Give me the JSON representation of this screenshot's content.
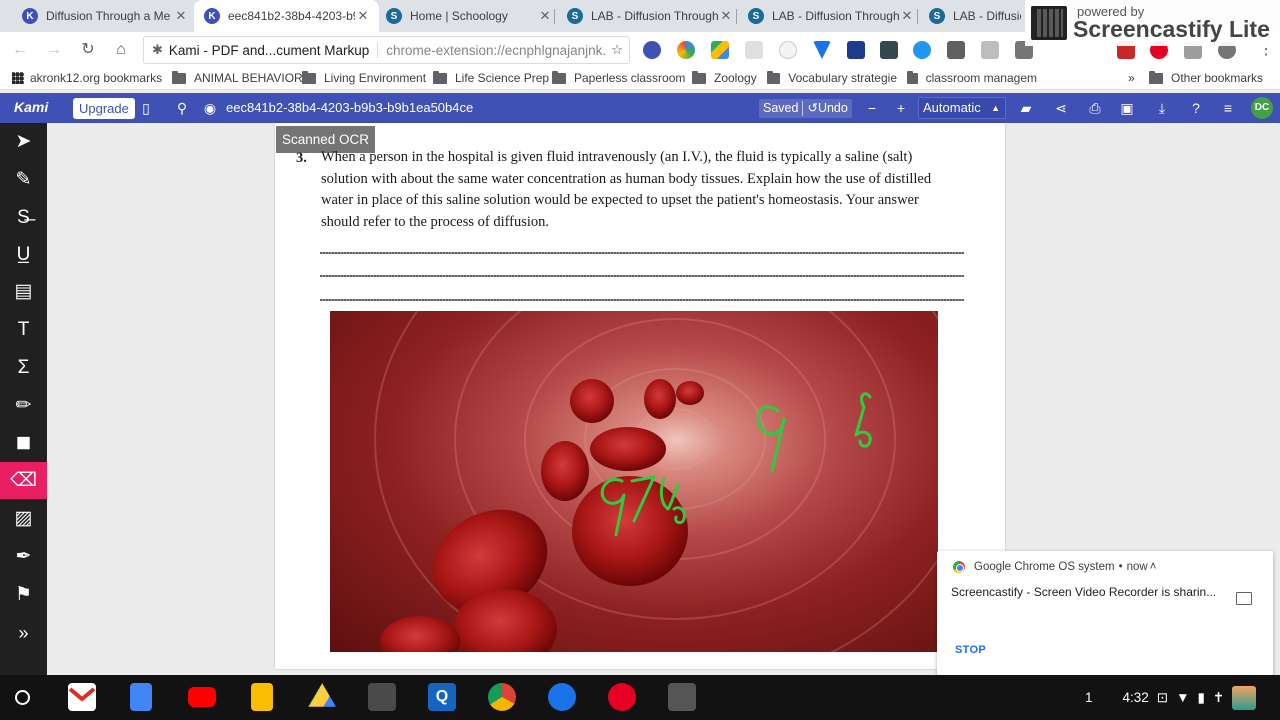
{
  "tabs": [
    {
      "title": "Diffusion Through a Me",
      "favicon": "K",
      "favicon_color": "#3f51b5",
      "active": false
    },
    {
      "title": "eec841b2-38b4-4203-b9",
      "favicon": "K",
      "favicon_color": "#3f51b5",
      "active": true
    },
    {
      "title": "Home | Schoology",
      "favicon": "S",
      "favicon_color": "#1a6a9a",
      "active": false
    },
    {
      "title": "LAB - Diffusion Through",
      "favicon": "S",
      "favicon_color": "#1a6a9a",
      "active": false
    },
    {
      "title": "LAB - Diffusion Through",
      "favicon": "S",
      "favicon_color": "#1a6a9a",
      "active": false
    },
    {
      "title": "LAB - Diffusion T",
      "favicon": "S",
      "favicon_color": "#1a6a9a",
      "active": false
    }
  ],
  "screencastify": {
    "line1": "powered by",
    "line2": "Screencastify Lite"
  },
  "omnibox": {
    "site": "Kami - PDF and...cument Markup",
    "url": "chrome-extension://ecnphlgnajanjnk..."
  },
  "bookmarks": {
    "apps": "akronk12.org bookmarks",
    "folders": [
      "ANIMAL BEHAVIOR",
      "Living Environment",
      "Life Science Prep",
      "Paperless classroom",
      "Zoology",
      "Vocabulary strategie",
      "classroom managem"
    ],
    "overflow": "»",
    "other": "Other bookmarks"
  },
  "kami": {
    "logo": "Kami",
    "upgrade": "Upgrade",
    "doc_id": "eec841b2-38b4-4203-b9b3-b9b1ea50b4ce",
    "saved": "Saved",
    "undo": "Undo",
    "zoom": "Automatic",
    "avatar": "DC"
  },
  "document": {
    "ocr_button": "Scanned OCR",
    "question_number": "3.",
    "question_text": "When a person in the hospital is given fluid intravenously (an I.V.), the fluid is typically a saline (salt) solution with about the same water concentration as human body tissues. Explain how the use of distilled water in place of this saline solution would be expected to upset the patient's homeostasis. Your answer should refer to the process of diffusion.",
    "annotation_1": "97%",
    "annotation_2": "9",
    "annotation_3": "%"
  },
  "notification": {
    "source": "Google Chrome OS system",
    "time": "now",
    "message": "Screencastify - Screen Video Recorder is sharin...",
    "action": "STOP"
  },
  "status": {
    "badge": "1",
    "time": "4:32"
  },
  "colors": {
    "kami_blue": "#3f51b5",
    "eraser_active": "#e91e63",
    "annotation_green": "#2ecc40"
  }
}
